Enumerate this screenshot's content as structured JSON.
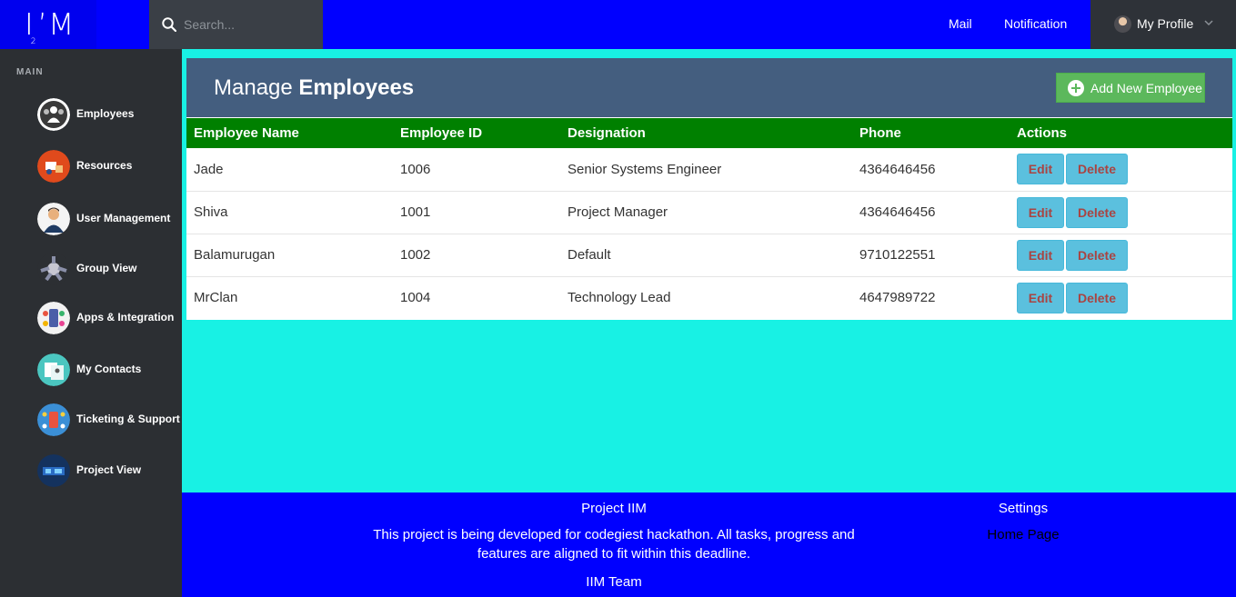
{
  "header": {
    "logo": {
      "main_left": "I",
      "sub": "2",
      "main_right": "’M"
    },
    "search": {
      "placeholder": "Search..."
    },
    "links": {
      "mail": "Mail",
      "notification": "Notification"
    },
    "profile": {
      "label": "My Profile"
    }
  },
  "sidebar": {
    "heading": "MAIN",
    "items": [
      {
        "label": "Employees",
        "icon": "employees-icon"
      },
      {
        "label": "Resources",
        "icon": "resources-icon"
      },
      {
        "label": "User Management",
        "icon": "user-management-icon"
      },
      {
        "label": "Group View",
        "icon": "group-view-icon"
      },
      {
        "label": "Apps & Integration",
        "icon": "apps-integration-icon"
      },
      {
        "label": "My Contacts",
        "icon": "contacts-icon"
      },
      {
        "label": "Ticketing & Support",
        "icon": "ticketing-icon"
      },
      {
        "label": "Project View",
        "icon": "project-view-icon"
      }
    ]
  },
  "panel": {
    "title_prefix": "Manage ",
    "title_strong": "Employees",
    "add_button": "Add New Employee",
    "columns": [
      "Employee Name",
      "Employee ID",
      "Designation",
      "Phone",
      "Actions"
    ],
    "rows": [
      {
        "name": "Jade",
        "id": "1006",
        "designation": "Senior Systems Engineer",
        "phone": "4364646456"
      },
      {
        "name": "Shiva",
        "id": "1001",
        "designation": "Project Manager",
        "phone": "4364646456"
      },
      {
        "name": "Balamurugan",
        "id": "1002",
        "designation": "Default",
        "phone": "9710122551"
      },
      {
        "name": "MrClan",
        "id": "1004",
        "designation": "Technology Lead",
        "phone": "4647989722"
      }
    ],
    "edit_label": "Edit",
    "delete_label": "Delete"
  },
  "footer": {
    "title": "Project IIM",
    "description": "This project is being developed for codegiest hackathon. All tasks, progress and features are aligned to fit within this deadline.",
    "team": "IIM Team",
    "settings": "Settings",
    "home_link": "Home Page"
  },
  "colors": {
    "topbar": "#0000ff",
    "sidebar": "#2c2f33",
    "content_bg": "#18f1e4",
    "panel_header": "#445e7f",
    "table_header": "#008000",
    "add_button": "#5cb85c",
    "action_button": "#5bc0de",
    "action_text": "#a94442"
  }
}
